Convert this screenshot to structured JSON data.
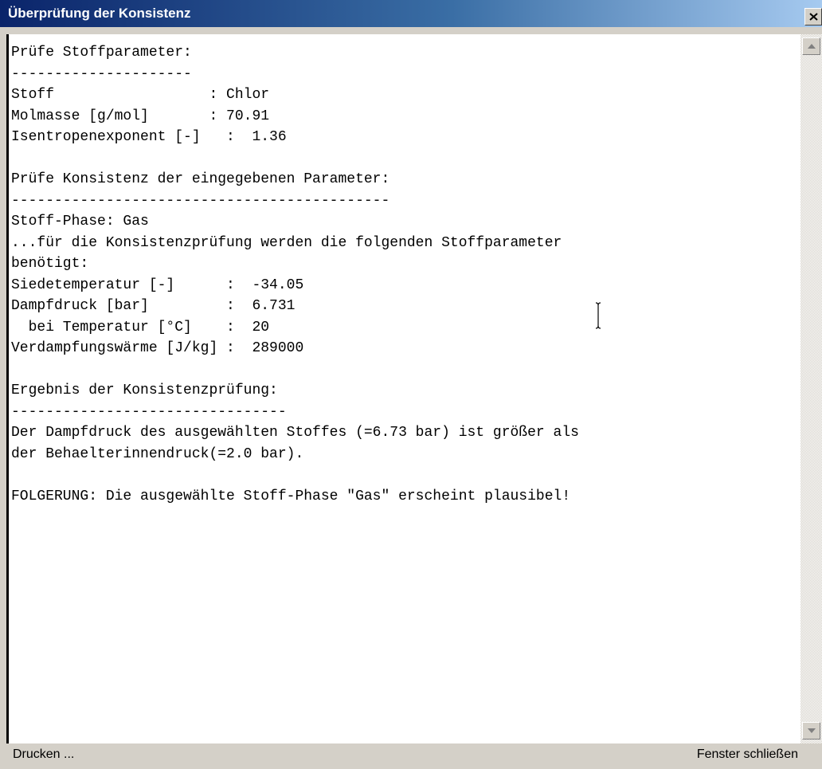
{
  "window": {
    "title": "Überprüfung der Konsistenz"
  },
  "report": {
    "text": "Prüfe Stoffparameter:\n---------------------\nStoff                  : Chlor\nMolmasse [g/mol]       : 70.91\nIsentropenexponent [-]   :  1.36\n\nPrüfe Konsistenz der eingegebenen Parameter:\n--------------------------------------------\nStoff-Phase: Gas\n...für die Konsistenzprüfung werden die folgenden Stoffparameter\nbenötigt:\nSiedetemperatur [-]      :  -34.05\nDampfdruck [bar]         :  6.731\n  bei Temperatur [°C]    :  20\nVerdampfungswärme [J/kg] :  289000\n\nErgebnis der Konsistenzprüfung:\n--------------------------------\nDer Dampfdruck des ausgewählten Stoffes (=6.73 bar) ist größer als\nder Behaelterinnendruck(=2.0 bar).\n\nFOLGERUNG: Die ausgewählte Stoff-Phase \"Gas\" erscheint plausibel!"
  },
  "buttons": {
    "print": "Drucken ...",
    "close_window": "Fenster schließen"
  },
  "icons": {
    "close": "close-icon",
    "scroll_up": "scroll-up-arrow-icon",
    "scroll_down": "scroll-down-arrow-icon",
    "text_cursor": "text-cursor-icon"
  }
}
